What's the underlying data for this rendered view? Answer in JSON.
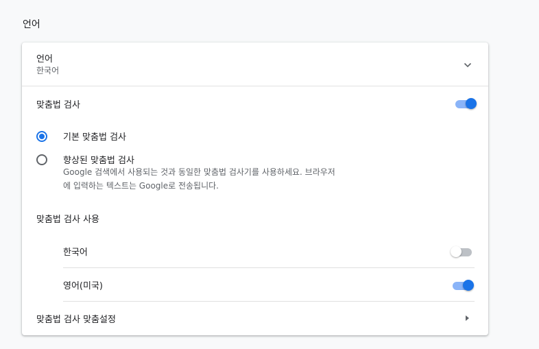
{
  "section": {
    "title": "언어"
  },
  "language_row": {
    "label": "언어",
    "value": "한국어",
    "icon": "chevron-down-icon"
  },
  "spellcheck": {
    "label": "맞춤법 검사",
    "enabled": true,
    "options": [
      {
        "label": "기본 맞춤법 검사",
        "selected": true
      },
      {
        "label": "향상된 맞춤법 검사",
        "selected": false,
        "description_line1": "Google 검색에서 사용되는 것과 동일한 맞춤법 검사기를 사용하세요. 브라우저",
        "description_line2": "에 입력하는 텍스트는 Google로 전송됩니다."
      }
    ],
    "use_label": "맞춤법 검사 사용",
    "languages": [
      {
        "name": "한국어",
        "enabled": false
      },
      {
        "name": "영어(미국)",
        "enabled": true
      }
    ],
    "customize_label": "맞춤법 검사 맞춤설정",
    "customize_icon": "arrow-right-icon"
  },
  "colors": {
    "accent": "#1a73e8",
    "accent_light": "#8ab4f8",
    "background": "#f8f9fa",
    "card": "#ffffff"
  }
}
